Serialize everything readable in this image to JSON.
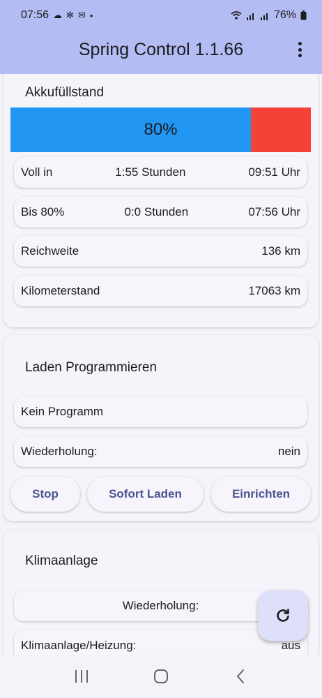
{
  "status_bar": {
    "time": "07:56",
    "battery_percent": "76%"
  },
  "app_bar": {
    "title": "Spring Control 1.1.66"
  },
  "battery_card": {
    "title": "Akkufüllstand",
    "charge_level": 0.8,
    "charge_label": "80%",
    "colors": {
      "filled": "#2196f3",
      "empty": "#f44336"
    },
    "rows": [
      {
        "label": "Voll in",
        "middle": "1:55 Stunden",
        "value": "09:51 Uhr"
      },
      {
        "label": "Bis 80%",
        "middle": "0:0 Stunden",
        "value": "07:56 Uhr"
      },
      {
        "label": "Reichweite",
        "value": "136 km"
      },
      {
        "label": "Kilometerstand",
        "value": "17063 km"
      }
    ]
  },
  "charge_card": {
    "title": "Laden Programmieren",
    "program": "Kein Programm",
    "repeat_label": "Wiederholung:",
    "repeat_value": "nein",
    "buttons": {
      "stop": "Stop",
      "charge_now": "Sofort Laden",
      "setup": "Einrichten"
    }
  },
  "climate_card": {
    "title": "Klimaanlage",
    "repeat_label": "Wiederholung:",
    "ac_label": "Klimaanlage/Heizung:",
    "ac_value": "aus"
  },
  "fab": {
    "icon": "refresh-icon"
  },
  "nav": {
    "icons": [
      "recent-apps-icon",
      "home-icon",
      "back-icon"
    ]
  }
}
